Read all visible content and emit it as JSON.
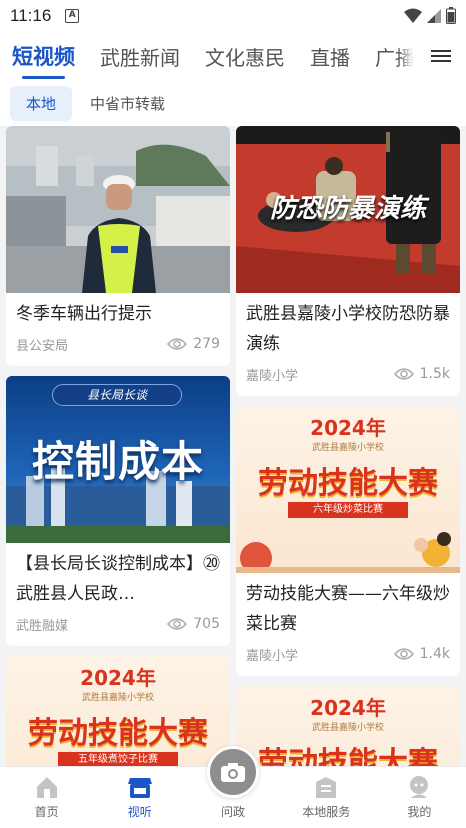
{
  "status_bar": {
    "time": "11:16"
  },
  "tabs": [
    {
      "label": "短视频",
      "active": true
    },
    {
      "label": "武胜新闻",
      "active": false
    },
    {
      "label": "文化惠民",
      "active": false
    },
    {
      "label": "直播",
      "active": false
    },
    {
      "label": "广播电",
      "active": false
    }
  ],
  "subtabs": [
    {
      "label": "本地",
      "active": true
    },
    {
      "label": "中省市转载",
      "active": false
    }
  ],
  "videos": [
    {
      "title": "冬季车辆出行提示",
      "source": "县公安局",
      "views": "279"
    },
    {
      "title": "武胜县嘉陵小学校防恐防暴演练",
      "source": "嘉陵小学",
      "views": "1.5k",
      "thumb_text": "防恐防暴演练"
    },
    {
      "title": "【县长局长谈控制成本】⑳武胜县人民政…",
      "source": "武胜融媒",
      "views": "705",
      "thumb_text": "控制成本",
      "thumb_badge": "县长局长谈"
    },
    {
      "title": "劳动技能大赛——六年级炒菜比赛",
      "source": "嘉陵小学",
      "views": "1.4k",
      "thumb_text": "劳动技能大赛",
      "thumb_year": "2024年",
      "thumb_sub": "六年级炒菜比赛",
      "thumb_school": "武胜县嘉陵小学校"
    },
    {
      "title": "",
      "source": "",
      "views": "",
      "thumb_text": "劳动技能大赛",
      "thumb_year": "2024年",
      "thumb_sub": "五年级煮饺子比赛",
      "thumb_school": "武胜县嘉陵小学校"
    },
    {
      "title": "",
      "source": "",
      "views": "",
      "thumb_text": "劳动技能大赛",
      "thumb_year": "2024年",
      "thumb_school": "武胜县嘉陵小学校"
    }
  ],
  "bottom_nav": [
    {
      "label": "首页",
      "icon": "home-icon"
    },
    {
      "label": "视听",
      "icon": "video-store-icon",
      "active": true
    },
    {
      "label": "问政",
      "icon": "camera-icon"
    },
    {
      "label": "本地服务",
      "icon": "service-icon"
    },
    {
      "label": "我的",
      "icon": "profile-icon"
    }
  ],
  "colors": {
    "accent": "#1a56c7",
    "labor_red": "#d9331f",
    "labor_gold": "#f2b233"
  }
}
